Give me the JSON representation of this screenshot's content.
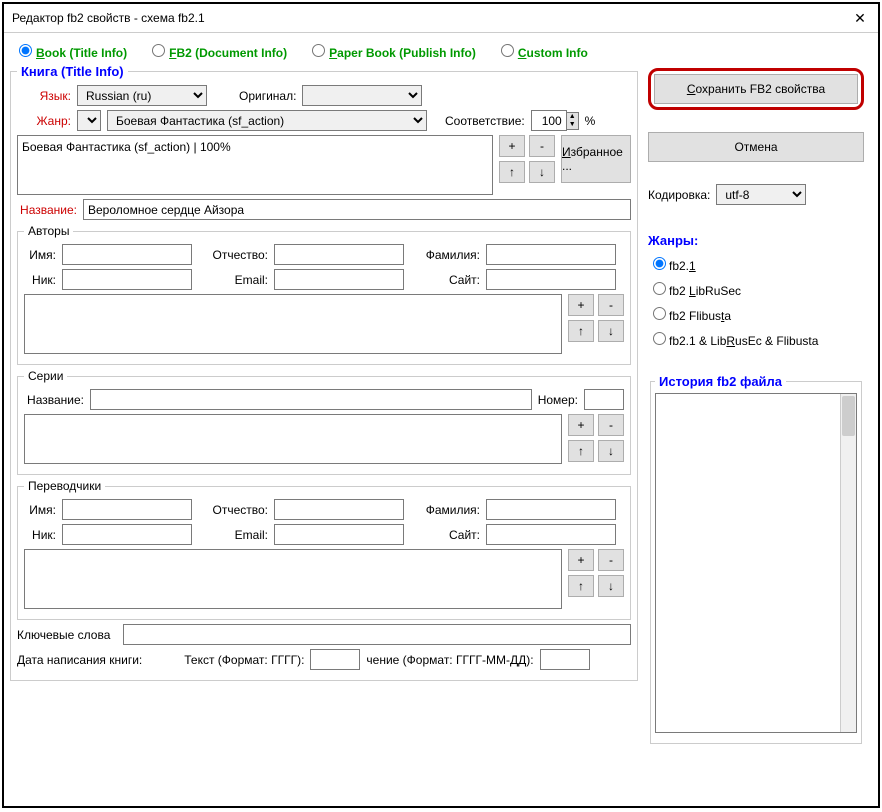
{
  "window": {
    "title": "Редактор fb2 свойств - схема fb2.1",
    "close": "✕"
  },
  "topnav": {
    "book": "Book (Title Info)",
    "fb2": "FB2 (Document Info)",
    "paper": "Paper Book (Publish Info)",
    "custom": "Custom Info"
  },
  "book": {
    "heading": "Книга (Title Info)",
    "lang_lbl": "Язык:",
    "lang_val": "Russian (ru)",
    "orig_lbl": "Оригинал:",
    "genre_lbl": "Жанр:",
    "genre_sel": "Боевая Фантастика (sf_action)",
    "match_lbl": "Соответствие:",
    "match_val": "100",
    "pct": "%",
    "genre_entry": "Боевая Фантастика (sf_action) | 100%",
    "fav": "Избранное ...",
    "plus": "+",
    "minus": "-",
    "up": "↑",
    "down": "↓",
    "title_lbl": "Название:",
    "title_val": "Вероломное сердце Айзора"
  },
  "authors": {
    "legend": "Авторы",
    "fname": "Имя:",
    "mname": "Отчество:",
    "lname": "Фамилия:",
    "nick": "Ник:",
    "email": "Email:",
    "site": "Сайт:"
  },
  "series": {
    "legend": "Серии",
    "title": "Название:",
    "num": "Номер:"
  },
  "translators": {
    "legend": "Переводчики",
    "fname": "Имя:",
    "mname": "Отчество:",
    "lname": "Фамилия:",
    "nick": "Ник:",
    "email": "Email:",
    "site": "Сайт:"
  },
  "footer": {
    "keywords": "Ключевые слова",
    "datewrit": "Дата написания книги:",
    "textfmt": "Текст (Формат: ГГГГ):",
    "valfmt": "чение (Формат: ГГГГ-ММ-ДД):"
  },
  "right": {
    "save": "Сохранить FB2 свойства",
    "cancel": "Отмена",
    "encoding_lbl": "Кодировка:",
    "encoding_val": "utf-8",
    "genres_hdr": "Жанры:",
    "g1": "fb2.1",
    "g2": "fb2 LibRuSec",
    "g3": "fb2 Flibusta",
    "g4": "fb2.1 & LibRusEc & Flibusta",
    "hist": "История fb2 файла"
  }
}
